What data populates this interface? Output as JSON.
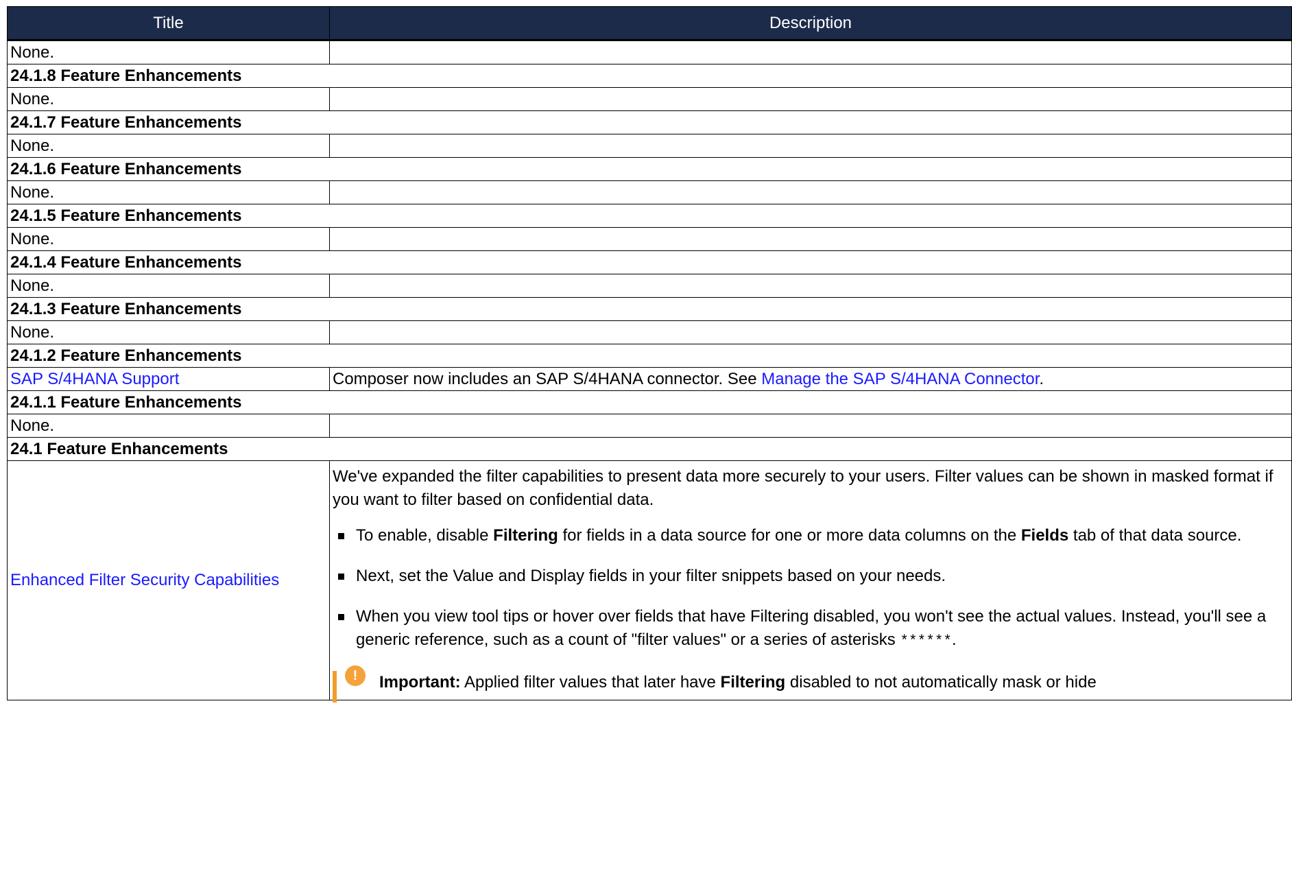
{
  "header": {
    "title": "Title",
    "description": "Description"
  },
  "rows": [
    {
      "title": "None.",
      "desc": ""
    },
    {
      "section": "24.1.8 Feature Enhancements"
    },
    {
      "title": "None.",
      "desc": ""
    },
    {
      "section": "24.1.7 Feature Enhancements"
    },
    {
      "title": "None.",
      "desc": ""
    },
    {
      "section": "24.1.6 Feature Enhancements"
    },
    {
      "title": "None.",
      "desc": ""
    },
    {
      "section": "24.1.5 Feature Enhancements"
    },
    {
      "title": "None.",
      "desc": ""
    },
    {
      "section": "24.1.4 Feature Enhancements"
    },
    {
      "title": "None.",
      "desc": ""
    },
    {
      "section": "24.1.3 Feature Enhancements"
    },
    {
      "title": "None.",
      "desc": ""
    },
    {
      "section": "24.1.2 Feature Enhancements"
    },
    {
      "title_link": "SAP S/4HANA Support",
      "desc_pre": "Composer now includes an SAP S/4HANA connector. See ",
      "desc_link": "Manage the SAP S/4HANA Connector",
      "desc_post": "."
    },
    {
      "section": "24.1.1 Feature Enhancements"
    },
    {
      "title": "None.",
      "desc": ""
    },
    {
      "section": "24.1 Feature Enhancements"
    }
  ],
  "feature": {
    "title_link": "Enhanced Filter Security Capabilities",
    "intro": "We've expanded the filter capabilities to present data more securely to your users. Filter values can be shown in masked format if you want to filter based on confidential data.",
    "bullet1": {
      "pre": "To enable, disable ",
      "b1": "Filtering",
      "mid": " for fields in a data source for one or more data columns on the ",
      "b2": "Fields",
      "post": " tab of that data source."
    },
    "bullet2": "Next, set the Value and Display fields in your filter snippets based on your needs.",
    "bullet3": {
      "pre": "When you view tool tips or hover over fields that have Filtering disabled, you won't see the actual values. Instead, you'll see a generic reference, such as a count of \"filter values\" or a series of asterisks ",
      "mask": "******",
      "post": "."
    },
    "note": {
      "label": "Important:",
      "pre": " Applied filter values that later have ",
      "b": "Filtering",
      "post": " disabled to not automatically mask or hide"
    }
  }
}
